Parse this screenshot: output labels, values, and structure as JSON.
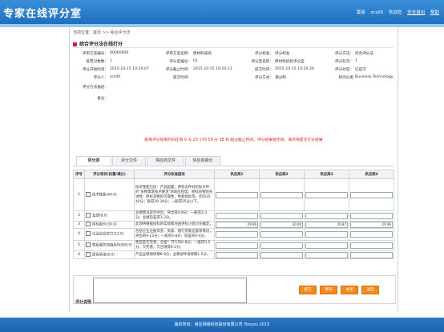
{
  "header": {
    "title": "专家在线评分室",
    "user_label": "黄丽",
    "user_name": "zcs00",
    "welcome": "欢迎您",
    "logout": "安全退出",
    "help": "帮助"
  },
  "breadcrumb": "当前位置：首页 >> 综合评分法",
  "section_title": "综合评分法在线打分",
  "info": [
    [
      [
        "评审方案编号：",
        "00000006"
      ],
      [
        "评审方案名称：",
        "原材料采购"
      ],
      [
        "评分标准：",
        "评分标准"
      ],
      [
        "评分方法：",
        "综合评分法"
      ]
    ],
    [
      [
        "投票对象数：",
        "1"
      ],
      [
        "评分室编号：",
        "01"
      ],
      [
        "评分室名称：",
        "原材料招标评分室"
      ],
      [
        "评分轮次：",
        "1"
      ]
    ],
    [
      [
        "评分开始时间：",
        "2015-10-15 10:20:07"
      ],
      [
        "评分截止时间：",
        "2015-10-15 10:20:11"
      ],
      [
        "提交时间：",
        "2015-10-15 10:20:29"
      ],
      [
        "评分状态：",
        "已提交"
      ]
    ],
    [
      [
        "评分人：",
        "zcs00"
      ],
      [
        "提交时间：",
        ""
      ],
      [
        "评分方式：",
        "满分制"
      ],
      [
        "标的分类",
        "Business,Technology"
      ]
    ],
    [
      [
        "评分方法描述：",
        ""
      ]
    ],
    [
      [
        "备注：",
        ""
      ]
    ]
  ],
  "warning": "距离评分结束时间还有 0 天 23 小时 59 分 38 秒 超过截止时间，评分结果将无效，请尽快提交打分结果",
  "tabs": [
    "评分表",
    "评分文件",
    "供应商文件",
    "供应商报价"
  ],
  "table": {
    "headers": [
      "序号",
      "评分项目(权重/满分)",
      "评分标准描述",
      "供应商1",
      "供应商2",
      "供应商3",
      "供应商4"
    ],
    "rows": [
      {
        "no": "1",
        "item": "技术性能(40.0)",
        "desc": "技术性能包括：产品配置；原标文件对招标文件的\"货物需求技术要求\"的响应程度；原标货物的先进性；原标货物的可靠性；性能指标等。优的35-40分；良得29-34分；一般得25分以下。",
        "vals": [
          "",
          "",
          "",
          ""
        ]
      },
      {
        "no": "2",
        "item": "业绩(8.0)",
        "desc": "业绩情况是否突出，突出得4-8分；一般得2-3分；业绩较差得1-2分。",
        "vals": [
          "",
          "",
          "",
          ""
        ]
      },
      {
        "no": "3",
        "item": "原标报价(30.0)",
        "desc": "此项将根据投标的实际情况由评标小组讨论确定。",
        "vals": [
          "29.96",
          "30.00",
          "29.87",
          "29.96"
        ]
      },
      {
        "no": "4",
        "item": "企业综合实力(12.0)",
        "desc": "包括企业注册资金、资质、银行贷款信誉等情况，突出的9-12分；一般的5-8分；较差的0-4分。",
        "vals": [
          "",
          "",
          "",
          ""
        ]
      },
      {
        "no": "5",
        "item": "售后服务措施及培训(8.0)",
        "desc": "售后是否完善，全面？可行的6-8分；一般得3-5分；欠完善。欠合理得0-2分。",
        "vals": [
          "",
          "",
          "",
          ""
        ]
      },
      {
        "no": "6",
        "item": "质保承诺(8.0)",
        "desc": "产品业绩保修期6-8分；主要部件保修期1-5分。",
        "vals": [
          "",
          "",
          "",
          ""
        ]
      }
    ]
  },
  "comment_label": "评分说明",
  "buttons": [
    "提交",
    "暂存",
    "关闭",
    "返回"
  ],
  "footer": "版权所有：用友网络科技股份有限公司 Yonyou 2015"
}
